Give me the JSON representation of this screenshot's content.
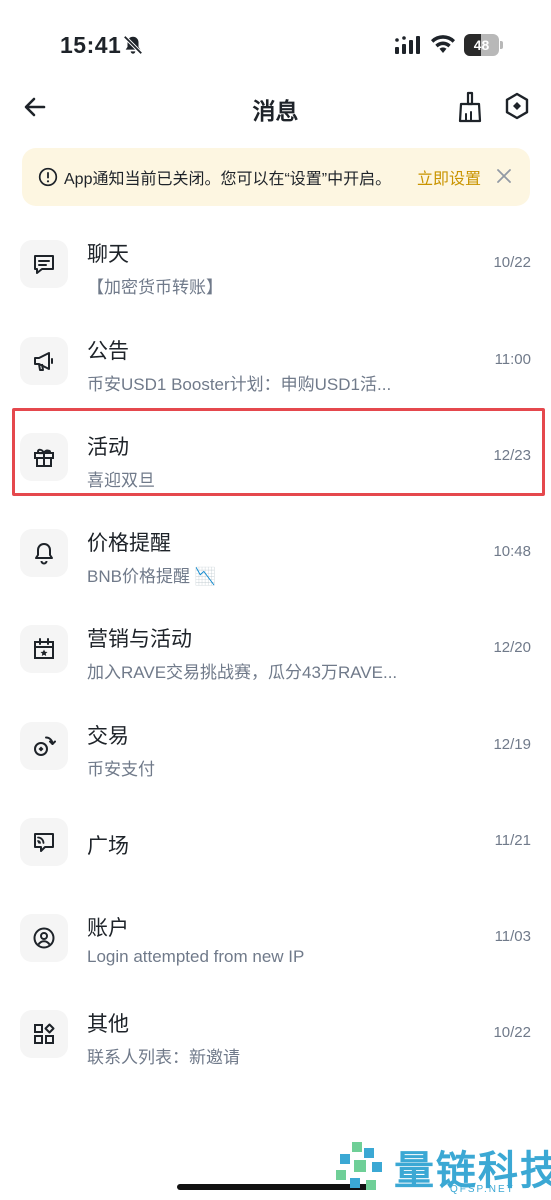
{
  "status_bar": {
    "time": "15:41",
    "battery": "48",
    "battery_level": 0.48
  },
  "header": {
    "title": "消息"
  },
  "notice": {
    "text": "App通知当前已关闭。您可以在“设置”中开启。",
    "link": "立即设置"
  },
  "messages": [
    {
      "title": "聊天",
      "subtitle": "【加密货币转账】",
      "time": "10/22",
      "icon": "chat-icon"
    },
    {
      "title": "公告",
      "subtitle": "币安USD1 Booster计划：申购USD1活...",
      "time": "11:00",
      "icon": "megaphone-icon"
    },
    {
      "title": "活动",
      "subtitle": "喜迎双旦",
      "time": "12/23",
      "icon": "gift-icon"
    },
    {
      "title": "价格提醒",
      "subtitle": "BNB价格提醒 📉",
      "time": "10:48",
      "icon": "bell-icon"
    },
    {
      "title": "营销与活动",
      "subtitle": "加入RAVE交易挑战赛，瓜分43万RAVE...",
      "time": "12/20",
      "icon": "calendar-icon"
    },
    {
      "title": "交易",
      "subtitle": "币安支付",
      "time": "12/19",
      "icon": "trade-icon"
    },
    {
      "title": "广场",
      "subtitle": "",
      "time": "11/21",
      "icon": "square-feed-icon"
    },
    {
      "title": "账户",
      "subtitle": "Login attempted from new IP",
      "time": "11/03",
      "icon": "account-icon"
    },
    {
      "title": "其他",
      "subtitle": "联系人列表：新邀请",
      "time": "10/22",
      "icon": "grid-icon"
    }
  ],
  "colors": {
    "accent": "#c99400",
    "banner_bg": "#fdf6e1",
    "highlight": "#e5484d"
  },
  "watermark": {
    "text": "量链科技",
    "sub": "QFSP.NET"
  }
}
